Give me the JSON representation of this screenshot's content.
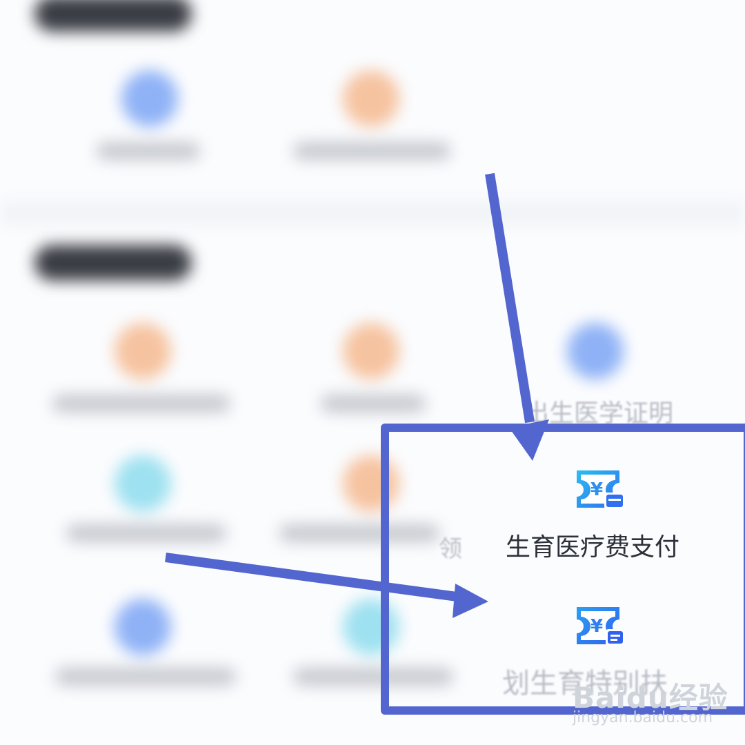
{
  "visible_items": {
    "birth_certificate": "出生医学证明",
    "medical_payment": "生育医疗费支付",
    "family_planning_partial": "划生育特别扶",
    "collect_partial": "领"
  },
  "icons": {
    "medical_payment_icon": "yuan-ticket-card-icon",
    "family_planning_icon": "yuan-ticket-document-icon"
  },
  "colors": {
    "highlight": "#5366d0",
    "icon_gradient_start": "#2bbdf0",
    "icon_gradient_end": "#2f6ff0"
  },
  "watermark": {
    "brand": "Baidu经验",
    "url": "jingyan.baidu.com"
  }
}
